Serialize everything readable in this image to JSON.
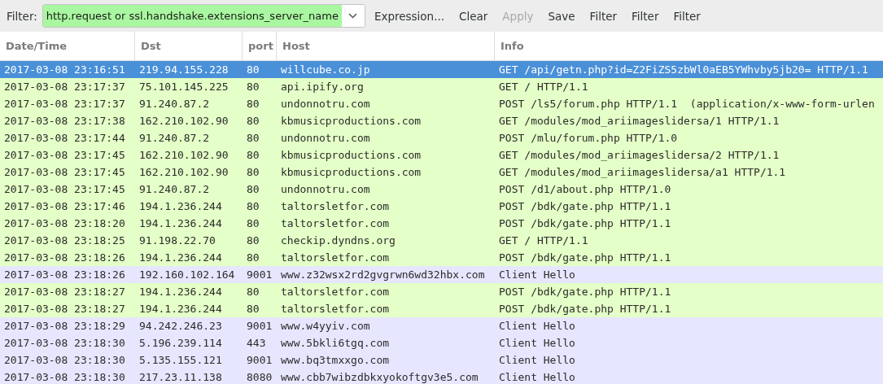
{
  "toolbar": {
    "filter_label": "Filter:",
    "filter_value": "http.request or ssl.handshake.extensions_server_name",
    "buttons": [
      {
        "label": "Expression...",
        "disabled": false
      },
      {
        "label": "Clear",
        "disabled": false
      },
      {
        "label": "Apply",
        "disabled": true
      },
      {
        "label": "Save",
        "disabled": false
      },
      {
        "label": "Filter",
        "disabled": false
      },
      {
        "label": "Filter",
        "disabled": false
      },
      {
        "label": "Filter",
        "disabled": false
      }
    ]
  },
  "table": {
    "columns": [
      "Date/Time",
      "Dst",
      "port",
      "Host",
      "Info"
    ],
    "rows": [
      {
        "cells": [
          "2017-03-08 23:16:51",
          "219.94.155.228",
          "80",
          "willcube.co.jp",
          "GET /api/getn.php?id=Z2FiZS5zbWl0aEB5YWhvby5jb20= HTTP/1.1"
        ],
        "selected": true
      },
      {
        "cells": [
          "2017-03-08 23:17:37",
          "75.101.145.225",
          "80",
          "api.ipify.org",
          "GET / HTTP/1.1"
        ],
        "color": "#e4ffc7",
        "selected": false
      },
      {
        "cells": [
          "2017-03-08 23:17:37",
          "91.240.87.2",
          "80",
          "undonnotru.com",
          "POST /ls5/forum.php HTTP/1.1  (application/x-www-form-urlen"
        ],
        "color": "#e4ffc7",
        "selected": false
      },
      {
        "cells": [
          "2017-03-08 23:17:38",
          "162.210.102.90",
          "80",
          "kbmusicproductions.com",
          "GET /modules/mod_ariimageslidersa/1 HTTP/1.1"
        ],
        "color": "#e4ffc7",
        "selected": false
      },
      {
        "cells": [
          "2017-03-08 23:17:44",
          "91.240.87.2",
          "80",
          "undonnotru.com",
          "POST /mlu/forum.php HTTP/1.0"
        ],
        "color": "#e4ffc7",
        "selected": false
      },
      {
        "cells": [
          "2017-03-08 23:17:45",
          "162.210.102.90",
          "80",
          "kbmusicproductions.com",
          "GET /modules/mod_ariimageslidersa/2 HTTP/1.1"
        ],
        "color": "#e4ffc7",
        "selected": false
      },
      {
        "cells": [
          "2017-03-08 23:17:45",
          "162.210.102.90",
          "80",
          "kbmusicproductions.com",
          "GET /modules/mod_ariimageslidersa/a1 HTTP/1.1"
        ],
        "color": "#e4ffc7",
        "selected": false
      },
      {
        "cells": [
          "2017-03-08 23:17:45",
          "91.240.87.2",
          "80",
          "undonnotru.com",
          "POST /d1/about.php HTTP/1.0"
        ],
        "color": "#e4ffc7",
        "selected": false
      },
      {
        "cells": [
          "2017-03-08 23:17:46",
          "194.1.236.244",
          "80",
          "taltorsletfor.com",
          "POST /bdk/gate.php HTTP/1.1"
        ],
        "color": "#e4ffc7",
        "selected": false
      },
      {
        "cells": [
          "2017-03-08 23:18:20",
          "194.1.236.244",
          "80",
          "taltorsletfor.com",
          "POST /bdk/gate.php HTTP/1.1"
        ],
        "color": "#e4ffc7",
        "selected": false
      },
      {
        "cells": [
          "2017-03-08 23:18:25",
          "91.198.22.70",
          "80",
          "checkip.dyndns.org",
          "GET / HTTP/1.1"
        ],
        "color": "#e4ffc7",
        "selected": false
      },
      {
        "cells": [
          "2017-03-08 23:18:26",
          "194.1.236.244",
          "80",
          "taltorsletfor.com",
          "POST /bdk/gate.php HTTP/1.1"
        ],
        "color": "#e4ffc7",
        "selected": false
      },
      {
        "cells": [
          "2017-03-08 23:18:26",
          "192.160.102.164",
          "9001",
          "www.z32wsx2rd2gvgrwn6wd32hbx.com",
          "Client Hello"
        ],
        "color": "#e7e6ff",
        "selected": false
      },
      {
        "cells": [
          "2017-03-08 23:18:27",
          "194.1.236.244",
          "80",
          "taltorsletfor.com",
          "POST /bdk/gate.php HTTP/1.1"
        ],
        "color": "#e4ffc7",
        "selected": false
      },
      {
        "cells": [
          "2017-03-08 23:18:27",
          "194.1.236.244",
          "80",
          "taltorsletfor.com",
          "POST /bdk/gate.php HTTP/1.1"
        ],
        "color": "#e4ffc7",
        "selected": false
      },
      {
        "cells": [
          "2017-03-08 23:18:29",
          "94.242.246.23",
          "9001",
          "www.w4yyiv.com",
          "Client Hello"
        ],
        "color": "#e7e6ff",
        "selected": false
      },
      {
        "cells": [
          "2017-03-08 23:18:30",
          "5.196.239.114",
          "443",
          "www.5bkli6tgq.com",
          "Client Hello"
        ],
        "color": "#e7e6ff",
        "selected": false
      },
      {
        "cells": [
          "2017-03-08 23:18:30",
          "5.135.155.121",
          "9001",
          "www.bq3tmxxgo.com",
          "Client Hello"
        ],
        "color": "#e7e6ff",
        "selected": false
      },
      {
        "cells": [
          "2017-03-08 23:18:30",
          "217.23.11.138",
          "8080",
          "www.cbb7wibzdbkxyokoftgv3e5.com",
          "Client Hello"
        ],
        "color": "#e7e6ff",
        "selected": false
      }
    ]
  }
}
